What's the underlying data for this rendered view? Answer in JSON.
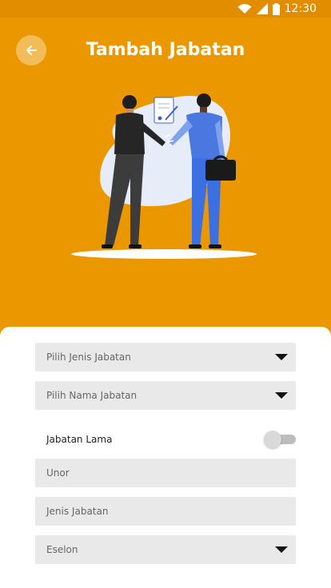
{
  "status_bar": {
    "time": "12:30"
  },
  "header": {
    "title": "Tambah Jabatan"
  },
  "form": {
    "jenis_jabatan_placeholder": "Pilih Jenis Jabatan",
    "nama_jabatan_placeholder": "Pilih Nama Jabatan",
    "jabatan_lama_label": "Jabatan Lama",
    "jabatan_lama_on": false,
    "unor_placeholder": "Unor",
    "jenis_jabatan_text_placeholder": "Jenis Jabatan",
    "eselon_placeholder": "Eselon"
  },
  "colors": {
    "accent": "#eb9800",
    "status_bar": "#e28d00",
    "field_bg": "#e9e9e9"
  },
  "icons": [
    "wifi-icon",
    "signal-icon",
    "battery-icon",
    "back-arrow-icon",
    "dropdown-caret-icon"
  ]
}
